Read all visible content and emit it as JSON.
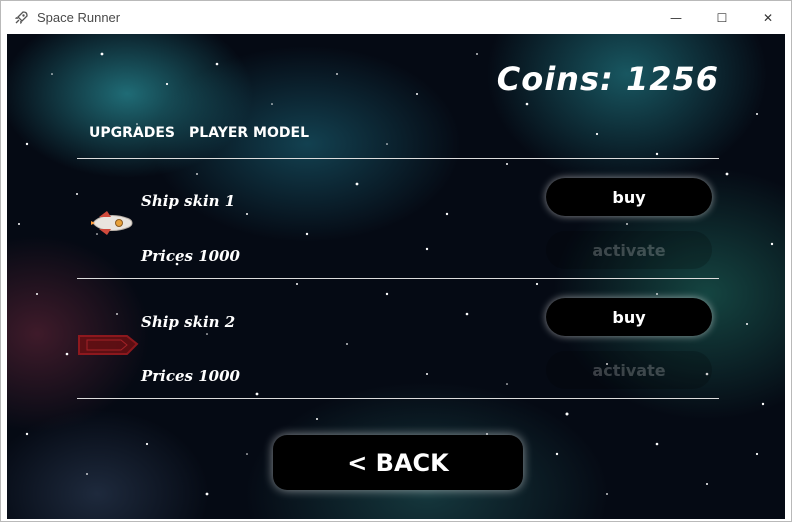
{
  "window": {
    "title": "Space Runner",
    "controls": {
      "minimize": "—",
      "maximize": "☐",
      "close": "✕"
    }
  },
  "game": {
    "coins_text": "Coins: 1256",
    "tabs": [
      {
        "label": "UPGRADES"
      },
      {
        "label": "PLAYER MODEL"
      }
    ],
    "items": [
      {
        "name": "Ship skin 1",
        "price": "Prices 1000",
        "buy_label": "buy",
        "activate_label": "activate",
        "ship_icon": "white-rocket-icon"
      },
      {
        "name": "Ship skin 2",
        "price": "Prices 1000",
        "buy_label": "buy",
        "activate_label": "activate",
        "ship_icon": "red-ship-icon"
      }
    ],
    "back_label": "< BACK"
  },
  "colors": {
    "button_bg": "#000000",
    "text": "#ffffff",
    "disabled_text": "rgba(255,255,255,0.22)"
  }
}
